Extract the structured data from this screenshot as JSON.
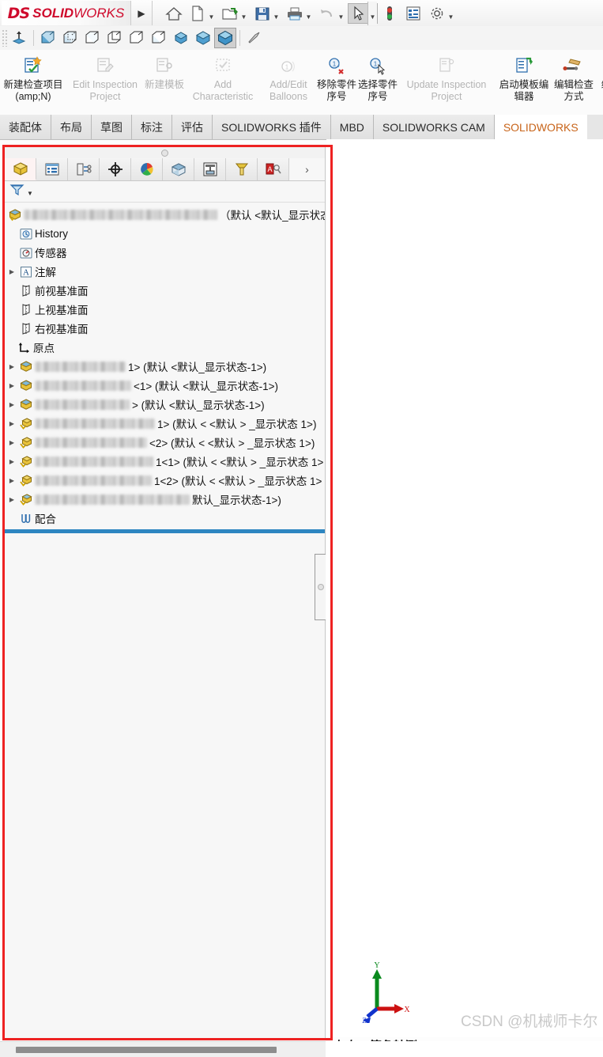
{
  "app": {
    "brand_ds": "DS",
    "brand_solid": "SOLID",
    "brand_works": "WORKS",
    "menu_arrow": "▶"
  },
  "menubar": {
    "items": [
      {
        "name": "home-icon",
        "glyph": "home",
        "caret": false
      },
      {
        "name": "new-document-icon",
        "glyph": "newdoc",
        "caret": true
      },
      {
        "name": "open-folder-icon",
        "glyph": "open",
        "caret": true
      },
      {
        "name": "save-icon",
        "glyph": "save",
        "caret": true
      },
      {
        "name": "print-icon",
        "glyph": "print",
        "caret": true
      },
      {
        "name": "undo-icon",
        "glyph": "undo",
        "caret": true
      },
      {
        "name": "select-tool-icon",
        "glyph": "cursor",
        "caret": true
      },
      {
        "name": "rebuild-icon",
        "glyph": "traffic",
        "caret": false
      },
      {
        "name": "options-list-icon",
        "glyph": "list",
        "caret": false
      },
      {
        "name": "settings-gear-icon",
        "glyph": "gear",
        "caret": true
      }
    ]
  },
  "viewbar": {
    "items": [
      {
        "name": "view-orientation-icon",
        "glyph": "orient",
        "active": false
      },
      {
        "name": "wireframe-icon",
        "glyph": "cube1",
        "active": false
      },
      {
        "name": "hidden-lines-visible-icon",
        "glyph": "cube2",
        "active": false
      },
      {
        "name": "hidden-lines-removed-icon",
        "glyph": "cube3",
        "active": false
      },
      {
        "name": "wireframe2-icon",
        "glyph": "cube4",
        "active": false
      },
      {
        "name": "shaded-wireframe-icon",
        "glyph": "cube5",
        "active": false
      },
      {
        "name": "wireframe3-icon",
        "glyph": "cube6",
        "active": false
      },
      {
        "name": "shaded-small-icon",
        "glyph": "solid1",
        "active": false
      },
      {
        "name": "shaded-medium-icon",
        "glyph": "solid2",
        "active": false
      },
      {
        "name": "shaded-active-icon",
        "glyph": "solid3",
        "active": true
      },
      {
        "name": "perspective-icon",
        "glyph": "scope",
        "active": false
      }
    ]
  },
  "ribbon": {
    "buttons": [
      {
        "name": "new-inspection-item-button",
        "label": "新建检查项目(amp;N)",
        "icon": "new-inspection-icon",
        "disabled": false,
        "size": "narrow"
      },
      {
        "name": "edit-inspection-project-button",
        "label": "Edit Inspection Project",
        "icon": "edit-inspection-icon",
        "disabled": true,
        "size": "normal"
      },
      {
        "name": "new-template-button",
        "label": "新建模板",
        "icon": "new-template-icon",
        "disabled": true,
        "size": "narrow"
      },
      {
        "name": "add-characteristic-button",
        "label": "Add Characteristic",
        "icon": "add-characteristic-icon",
        "disabled": true,
        "size": "normal"
      },
      {
        "name": "add-edit-balloons-button",
        "label": "Add/Edit Balloons",
        "icon": "balloons-icon",
        "disabled": true,
        "size": "normal"
      },
      {
        "name": "remove-part-number-button",
        "label": "移除零件序号",
        "icon": "remove-balloon-icon",
        "disabled": false,
        "size": "narrow"
      },
      {
        "name": "select-part-number-button",
        "label": "选择零件序号",
        "icon": "select-balloon-icon",
        "disabled": false,
        "size": "narrow"
      },
      {
        "name": "update-inspection-project-button",
        "label": "Update Inspection Project",
        "icon": "update-inspection-icon",
        "disabled": true,
        "size": "wide"
      },
      {
        "name": "launch-template-editor-button",
        "label": "启动模板编辑器",
        "icon": "template-editor-icon",
        "disabled": false,
        "size": "narrow"
      },
      {
        "name": "edit-inspection-method-button",
        "label": "编辑检查方式",
        "icon": "edit-method-icon",
        "disabled": false,
        "size": "narrow"
      },
      {
        "name": "edit-overflow-button",
        "label": "编",
        "icon": "overflow-icon",
        "disabled": false,
        "size": "narrow"
      }
    ]
  },
  "tabs": [
    {
      "name": "tab-assembly",
      "label": "装配体",
      "active": false
    },
    {
      "name": "tab-layout",
      "label": "布局",
      "active": false
    },
    {
      "name": "tab-sketch",
      "label": "草图",
      "active": false
    },
    {
      "name": "tab-annotation",
      "label": "标注",
      "active": false
    },
    {
      "name": "tab-evaluate",
      "label": "评估",
      "active": false
    },
    {
      "name": "tab-solidworks-addins",
      "label": "SOLIDWORKS 插件",
      "active": false
    },
    {
      "name": "tab-mbd",
      "label": "MBD",
      "active": false
    },
    {
      "name": "tab-solidworks-cam",
      "label": "SOLIDWORKS CAM",
      "active": false
    },
    {
      "name": "tab-solidworks-inspection",
      "label": "SOLIDWORKS",
      "active": true
    }
  ],
  "feature_manager": {
    "tabs": [
      {
        "name": "fm-tab-feature-tree",
        "icon": "yellow-cube-icon",
        "active": true
      },
      {
        "name": "fm-tab-property-manager",
        "icon": "property-list-icon",
        "active": false
      },
      {
        "name": "fm-tab-configuration-manager",
        "icon": "configuration-icon",
        "active": false
      },
      {
        "name": "fm-tab-dimxpert",
        "icon": "dimxpert-target-icon",
        "active": false
      },
      {
        "name": "fm-tab-display-manager",
        "icon": "color-wheel-icon",
        "active": false
      },
      {
        "name": "fm-tab-solidworks-addin",
        "icon": "render-cube-icon",
        "active": false
      },
      {
        "name": "fm-tab-simulation",
        "icon": "simulation-icon",
        "active": false
      },
      {
        "name": "fm-tab-cam-feature-tree",
        "icon": "cam-tool-icon",
        "active": false
      },
      {
        "name": "fm-tab-inspection",
        "icon": "inspection-icon",
        "active": false
      }
    ],
    "more_glyph": "›",
    "filter": {
      "name": "tree-filter-icon",
      "glyph": "funnel"
    },
    "tree": [
      {
        "name": "tree-root-assembly",
        "indent": 0,
        "arrow": false,
        "icon": "assembly-icon",
        "blur": 245,
        "text": "（默认 <默认_显示状态"
      },
      {
        "name": "tree-item-history",
        "indent": 1,
        "arrow": false,
        "icon": "history-icon",
        "blur": 0,
        "text": "History"
      },
      {
        "name": "tree-item-sensors",
        "indent": 1,
        "arrow": false,
        "icon": "sensors-icon",
        "blur": 0,
        "text": "传感器"
      },
      {
        "name": "tree-item-annotations",
        "indent": 1,
        "arrow": true,
        "icon": "annotations-icon",
        "blur": 0,
        "text": "注解"
      },
      {
        "name": "tree-item-front-plane",
        "indent": 1,
        "arrow": false,
        "icon": "plane-icon",
        "blur": 0,
        "text": "前视基准面"
      },
      {
        "name": "tree-item-top-plane",
        "indent": 1,
        "arrow": false,
        "icon": "plane-icon",
        "blur": 0,
        "text": "上视基准面"
      },
      {
        "name": "tree-item-right-plane",
        "indent": 1,
        "arrow": false,
        "icon": "plane-icon",
        "blur": 0,
        "text": "右视基准面"
      },
      {
        "name": "tree-item-origin",
        "indent": 1,
        "arrow": false,
        "icon": "origin-icon",
        "blur": 0,
        "text": "原点"
      },
      {
        "name": "tree-item-component-1",
        "indent": 1,
        "arrow": true,
        "icon": "component-icon",
        "blur": 115,
        "text": "1> (默认 <默认_显示状态-1>)"
      },
      {
        "name": "tree-item-component-2",
        "indent": 1,
        "arrow": true,
        "icon": "component-icon",
        "blur": 122,
        "text": "<1> (默认 <默认_显示状态-1>)"
      },
      {
        "name": "tree-item-component-3",
        "indent": 1,
        "arrow": true,
        "icon": "component-icon",
        "blur": 120,
        "text": "> (默认 <默认_显示状态-1>)"
      },
      {
        "name": "tree-item-subassembly-1",
        "indent": 1,
        "arrow": true,
        "icon": "subassembly-icon",
        "blur": 152,
        "text": "1> (默认 < <默认 > _显示状态 1>)"
      },
      {
        "name": "tree-item-subassembly-2",
        "indent": 1,
        "arrow": true,
        "icon": "subassembly-icon",
        "blur": 142,
        "text": "<2> (默认 < <默认 > _显示状态 1>)"
      },
      {
        "name": "tree-item-subassembly-3",
        "indent": 1,
        "arrow": true,
        "icon": "subassembly-icon",
        "blur": 150,
        "text": "1<1> (默认 < <默认 > _显示状态 1>"
      },
      {
        "name": "tree-item-subassembly-4",
        "indent": 1,
        "arrow": true,
        "icon": "subassembly-icon",
        "blur": 148,
        "text": "1<2> (默认 < <默认 > _显示状态 1>"
      },
      {
        "name": "tree-item-subassembly-5",
        "indent": 1,
        "arrow": true,
        "icon": "subassembly-icon",
        "blur": 196,
        "text": "默认_显示状态-1>)"
      },
      {
        "name": "tree-item-mates",
        "indent": 1,
        "arrow": false,
        "icon": "mates-icon",
        "blur": 0,
        "text": "配合"
      }
    ]
  },
  "graphics": {
    "triad": {
      "x_label": "X",
      "y_label": "Y",
      "z_label": "Z"
    },
    "view_label": "*左右二等角轴测",
    "watermark": "CSDN @机械师卡尔"
  }
}
